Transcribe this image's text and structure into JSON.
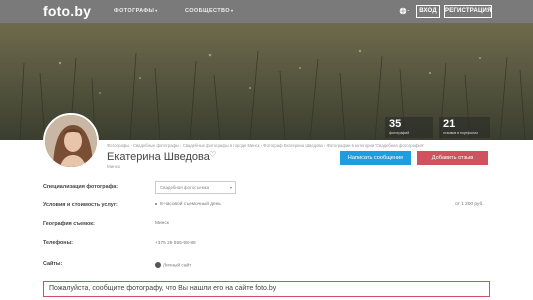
{
  "header": {
    "logo": "foto.by",
    "nav": [
      {
        "label": "ФОТОГРАФЫ"
      },
      {
        "label": "СООБЩЕСТВО"
      }
    ],
    "login_label": "ВХОД",
    "register_label": "РЕГИСТРАЦИЯ",
    "globe_icon": "globe-icon"
  },
  "stats": [
    {
      "value": "35",
      "label": "фотографий"
    },
    {
      "value": "21",
      "label": "отзывов в портфолио"
    }
  ],
  "profile": {
    "breadcrumb": "Фотографы › Свадебные фотографы › Свадебные фотографы в городе Минск › Фотограф Екатерина Шведова › Фотографии в категории 'Свадебная фотография'",
    "name": "Екатерина Шведова",
    "city": "Минск",
    "message_button": "Написать сообщение",
    "review_button": "Добавить отзыв"
  },
  "details": {
    "specialization_label": "Специализация фотографа:",
    "specialization_value": "Свадебная фотосъемка",
    "services_label": "Условия и стоимость услуг:",
    "service_item": "8-часовой съемочный день",
    "service_price": "от 1 200 руб.",
    "geography_label": "География съемок:",
    "geography_value": "Минск",
    "phones_label": "Телефоны:",
    "phone_value": "+375 29 555-98-88",
    "sites_label": "Сайты:",
    "site_value": "Личный сайт"
  },
  "notice": "Пожалуйста, сообщите фотографу, что Вы нашли его на сайте foto.by",
  "colors": {
    "topbar": "#7a7a7a",
    "primary_button": "#1e9ee0",
    "secondary_button": "#d0525f"
  }
}
